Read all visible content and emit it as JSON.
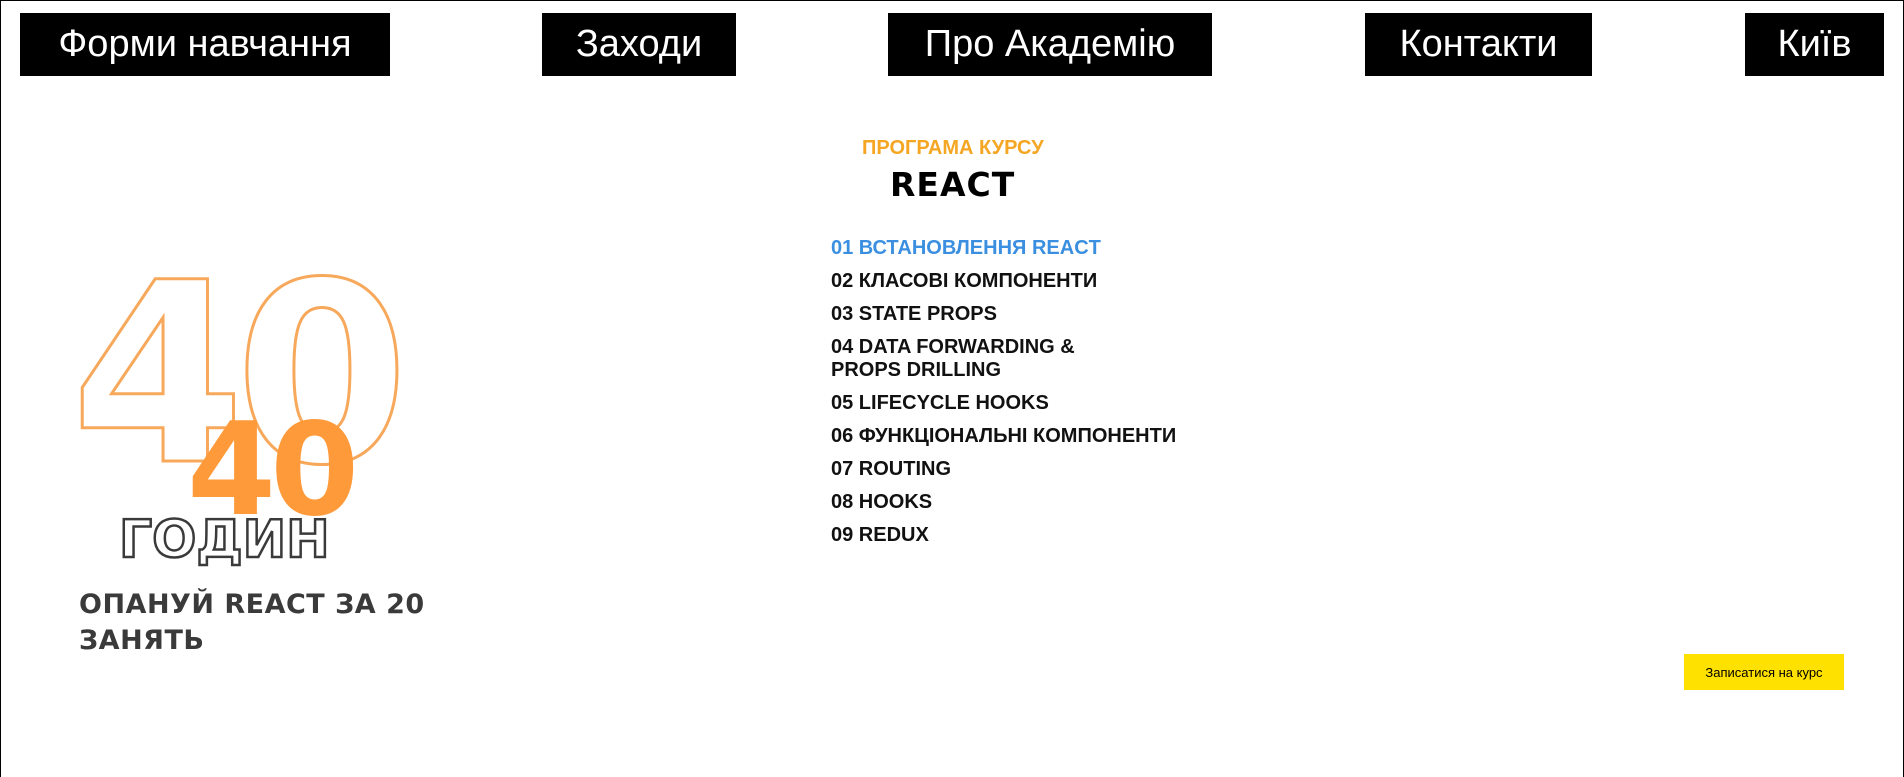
{
  "nav": {
    "forms": "Форми навчання",
    "events": "Заходи",
    "about": "Про Академію",
    "contacts": "Контакти",
    "city": "Київ"
  },
  "hero": {
    "big_number": "40",
    "number": "40",
    "unit": "ГОДИН",
    "slogan": "ОПАНУЙ REACT ЗА 20 ЗАНЯТЬ",
    "accent_color": "#ff9a3a"
  },
  "program": {
    "kicker": "ПРОГРАМА КУРСУ",
    "title": "REACT",
    "kicker_color": "#f5a623",
    "active_color": "#3a8fe0",
    "modules": [
      "01 ВСТАНОВЛЕННЯ REACT",
      "02 КЛАСОВІ КОМПОНЕНТИ",
      "03 STATE PROPS",
      "04 DATA FORWARDING & PROPS DRILLING",
      "05 LIFECYCLE HOOKS",
      "06 ФУНКЦІОНАЛЬНІ КОМПОНЕНТИ",
      "07 ROUTING",
      "08 HOOKS",
      "09 REDUX"
    ]
  },
  "cta": {
    "signup": "Записатися на курс",
    "color": "#ffe100"
  }
}
